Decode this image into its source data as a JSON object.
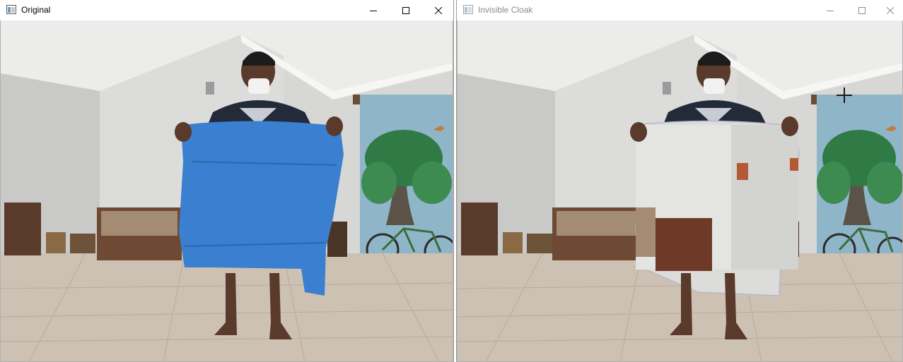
{
  "windows": {
    "left": {
      "title": "Original",
      "state": "active"
    },
    "right": {
      "title": "Invisible Cloak",
      "state": "inactive"
    }
  },
  "icons": {
    "app": "app-window-icon",
    "minimize": "minimize-icon",
    "maximize": "maximize-icon",
    "close": "close-icon"
  },
  "colors": {
    "cloak": "#3b7fd0",
    "wall": "#d9d9d9",
    "ceiling": "#ececec",
    "floor": "#cbbfb1",
    "mural_sky": "#8fb5c9",
    "tree": "#2f7a45",
    "shirt": "#232a3a"
  }
}
